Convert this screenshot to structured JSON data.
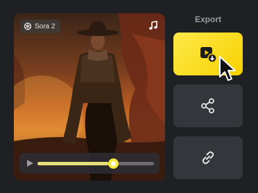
{
  "video": {
    "badge_label": "Sora 2",
    "progress": 0.65
  },
  "export_panel": {
    "title": "Export",
    "actions": [
      {
        "name": "export-video",
        "icon": "video-download-icon"
      },
      {
        "name": "share",
        "icon": "share-icon"
      },
      {
        "name": "copy-link",
        "icon": "link-icon"
      }
    ]
  },
  "colors": {
    "accent": "#f7d200",
    "panel_bg": "#1f2024",
    "button_bg": "#35363b",
    "progress_fill": "#e7e079"
  }
}
